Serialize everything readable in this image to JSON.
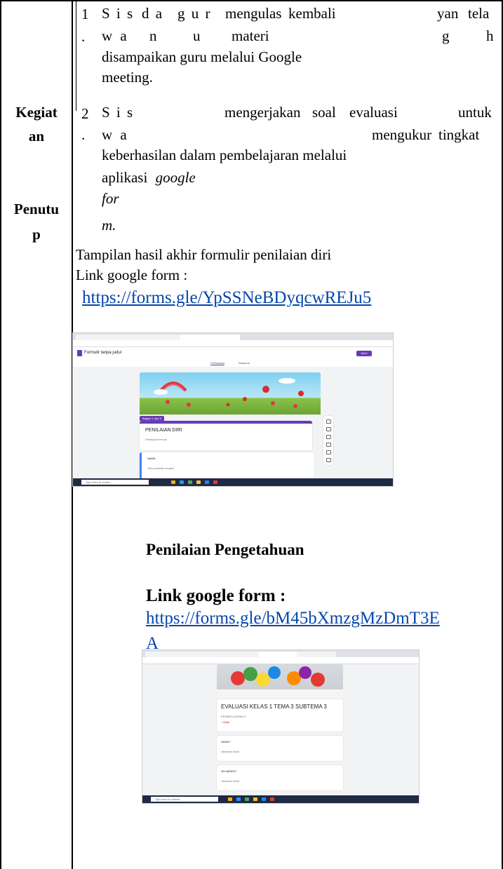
{
  "left_column": {
    "label_1": "Kegiat",
    "label_2": "an",
    "label_3": "Penutu",
    "label_4": "p"
  },
  "items": [
    {
      "number": "1",
      "dot": ".",
      "line1_parts": [
        "S i s",
        "d a",
        "g u r",
        "mengulas",
        "kembali",
        "yan",
        "tela"
      ],
      "line2_parts": [
        "w a",
        "n",
        "u",
        "materi",
        "g",
        "h"
      ],
      "line3": "disampaikan guru melalui Google",
      "line4": "meeting."
    },
    {
      "number": "2",
      "dot": ".",
      "line1_parts": [
        "S i s",
        "mengerjakan",
        "soal",
        "evaluasi",
        "untuk"
      ],
      "line2_parts": [
        "w a",
        "mengukur",
        "tingkat"
      ],
      "line3": "keberhasilan dalam pembelajaran melalui",
      "line4_prefix": "aplikasi",
      "line4_italic": "google",
      "line5": "for",
      "line6": "m."
    }
  ],
  "section1": {
    "caption": "Tampilan hasil akhir formulir penilaian diri",
    "link_label": "Link google form :",
    "link_url": "https://forms.gle/YpSSNeBDyqcwREJu5"
  },
  "screenshot1": {
    "form_title": "Formulir tanpa judul",
    "send_label": "Kirim",
    "tab_questions": "Pertanyaan",
    "tab_responses": "Respons",
    "section_tag": "Bagian 1 dari 3",
    "card_title": "PENILAIAN DIRI",
    "card_desc": "Deskripsi formulir",
    "q_label": "NAMA",
    "q_hint": "Teks jawaban singkat",
    "search_placeholder": "Type here to search",
    "colors": {
      "accent": "#673ab7",
      "taskbar": "#1f2a44"
    }
  },
  "section2": {
    "heading": "Penilaian Pengetahuan",
    "link_label": "Link google form :",
    "link_url_line1": "https://forms.gle/bM45bXmzgMzDmT3E",
    "link_url_line2": "A"
  },
  "screenshot2": {
    "form_title": "EVALUASI KELAS 1 TEMA 3 SUBTEMA 3",
    "subtitle": "PEMBELAJARAN 3",
    "required": "* Wajib",
    "q1_label": "NAMA *",
    "q1_hint": "Jawaban Anda",
    "q2_label": "NO ABSEN *",
    "q2_hint": "Jawaban Anda",
    "search_placeholder": "Type here to search"
  }
}
